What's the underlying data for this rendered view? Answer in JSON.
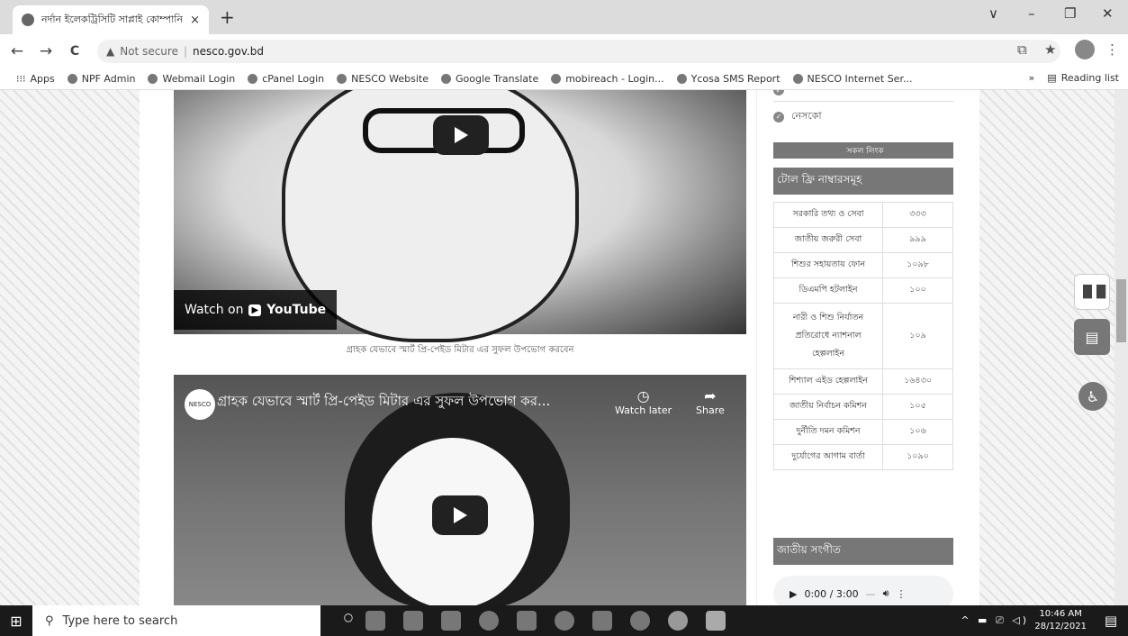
{
  "browser": {
    "tab_title": "নর্দান ইলেকট্রিসিটি সাপ্লাই কোম্পানি",
    "tab_close": "×",
    "new_tab": "+",
    "back": "←",
    "forward": "→",
    "reload": "C",
    "security_warning": "Not secure",
    "url": "nesco.gov.bd",
    "win_minimize": "–",
    "win_maximize": "❐",
    "win_close": "✕",
    "win_dropdown": "∨"
  },
  "bookmarks": [
    {
      "label": "Apps"
    },
    {
      "label": "NPF Admin"
    },
    {
      "label": "Webmail Login"
    },
    {
      "label": "cPanel Login"
    },
    {
      "label": "NESCO Website"
    },
    {
      "label": "Google Translate"
    },
    {
      "label": "mobireach - Login..."
    },
    {
      "label": "Ycosa SMS Report"
    },
    {
      "label": "NESCO Internet Ser..."
    }
  ],
  "bookmarks_more": "»",
  "reading_list": "Reading list",
  "video1": {
    "watch_on": "Watch on",
    "youtube": "YouTube"
  },
  "video_caption": "গ্রাহক যেভাবে স্মার্ট প্রি-পেইড মিটার এর সুফল উপভোগ করবেন",
  "video2": {
    "channel": "NESCO",
    "title": "গ্রাহক যেভাবে স্মার্ট প্রি-পেইড মিটার এর সুফল উপভোগ কর...",
    "watch_later": "Watch later",
    "share": "Share"
  },
  "sidebar": {
    "link_item": "নেসকো",
    "more_bar": "সকল লিংক",
    "hotline_title": "টোল ফ্রি নাম্বারসমূহ",
    "hotlines": [
      {
        "name": "সরকারি তথ্য ও সেবা",
        "number": "৩৩৩"
      },
      {
        "name": "জাতীয় জরুরী সেবা",
        "number": "৯৯৯"
      },
      {
        "name": "শিশুর সহায়তায় ফোন",
        "number": "১০৯৮"
      },
      {
        "name": "ডিএমপি হটলাইন",
        "number": "১০০"
      },
      {
        "name": "নারী ও শিশু নির্যাতন প্রতিরোধে ন্যাশনাল হেল্পলাইন",
        "number": "১০৯"
      },
      {
        "name": "শিশ্যাল এইড হেল্পলাইন",
        "number": "১৬৪৩০"
      },
      {
        "name": "জাতীয় নির্বাচন কমিশন",
        "number": "১০৫"
      },
      {
        "name": "দুর্নীতি দমন কমিশন",
        "number": "১০৬"
      },
      {
        "name": "দুর্যোগের আগাম বার্তা",
        "number": "১০৯০"
      }
    ],
    "anthem_title": "জাতীয় সংগীত",
    "audio_time": "0:00 / 3:00"
  },
  "taskbar": {
    "search_placeholder": "Type here to search",
    "time": "10:46 AM",
    "date": "28/12/2021"
  }
}
